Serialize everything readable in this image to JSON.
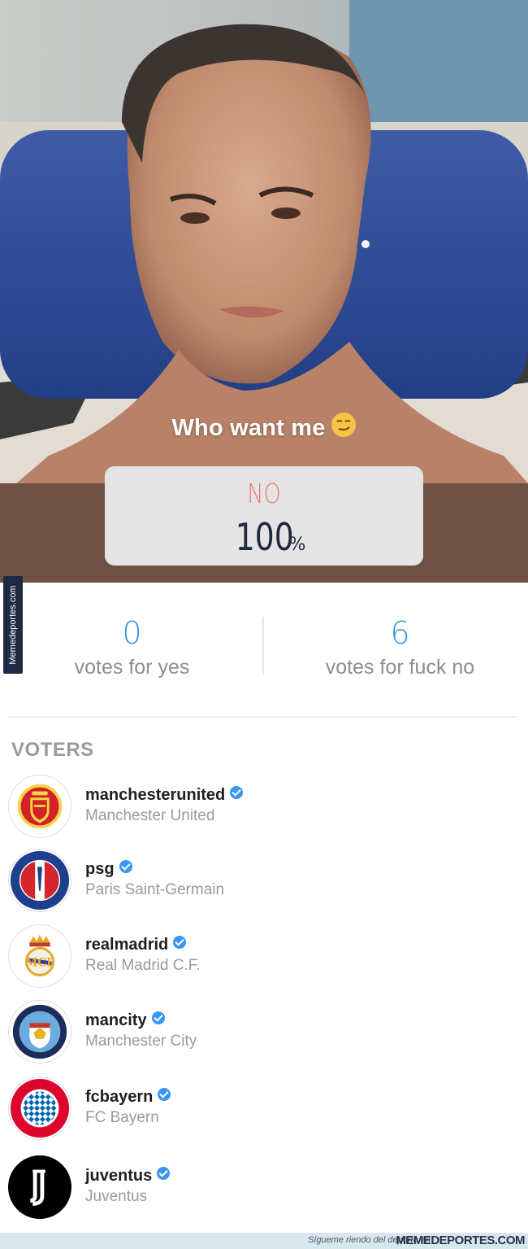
{
  "story": {
    "caption": "Who want me",
    "caption_emoji": "😏",
    "poll": {
      "option": "NO",
      "result_value": "100",
      "result_unit": "%"
    }
  },
  "watermark": {
    "side_text": "Memedeportes.com",
    "footer_text": "Sígueme riendo del deporte en",
    "footer_brand": "MEMEDEPORTES.COM"
  },
  "counts": {
    "yes": {
      "value": "0",
      "label": "votes for yes"
    },
    "no": {
      "value": "6",
      "label": "votes for fuck no"
    }
  },
  "voters_title": "VOTERS",
  "voters": [
    {
      "handle": "manchesterunited",
      "name": "Manchester United",
      "verified": true,
      "avatar_icon": "manchester-united-crest-icon"
    },
    {
      "handle": "psg",
      "name": "Paris Saint-Germain",
      "verified": true,
      "avatar_icon": "psg-crest-icon"
    },
    {
      "handle": "realmadrid",
      "name": "Real Madrid C.F.",
      "verified": true,
      "avatar_icon": "real-madrid-crest-icon"
    },
    {
      "handle": "mancity",
      "name": "Manchester City",
      "verified": true,
      "avatar_icon": "manchester-city-crest-icon"
    },
    {
      "handle": "fcbayern",
      "name": "FC Bayern",
      "verified": true,
      "avatar_icon": "fc-bayern-crest-icon"
    },
    {
      "handle": "juventus",
      "name": "Juventus",
      "verified": true,
      "avatar_icon": "juventus-logo-icon"
    }
  ],
  "colors": {
    "accent_blue": "#3897d6",
    "poll_no": "#f07a6a",
    "verified": "#3897f0"
  }
}
